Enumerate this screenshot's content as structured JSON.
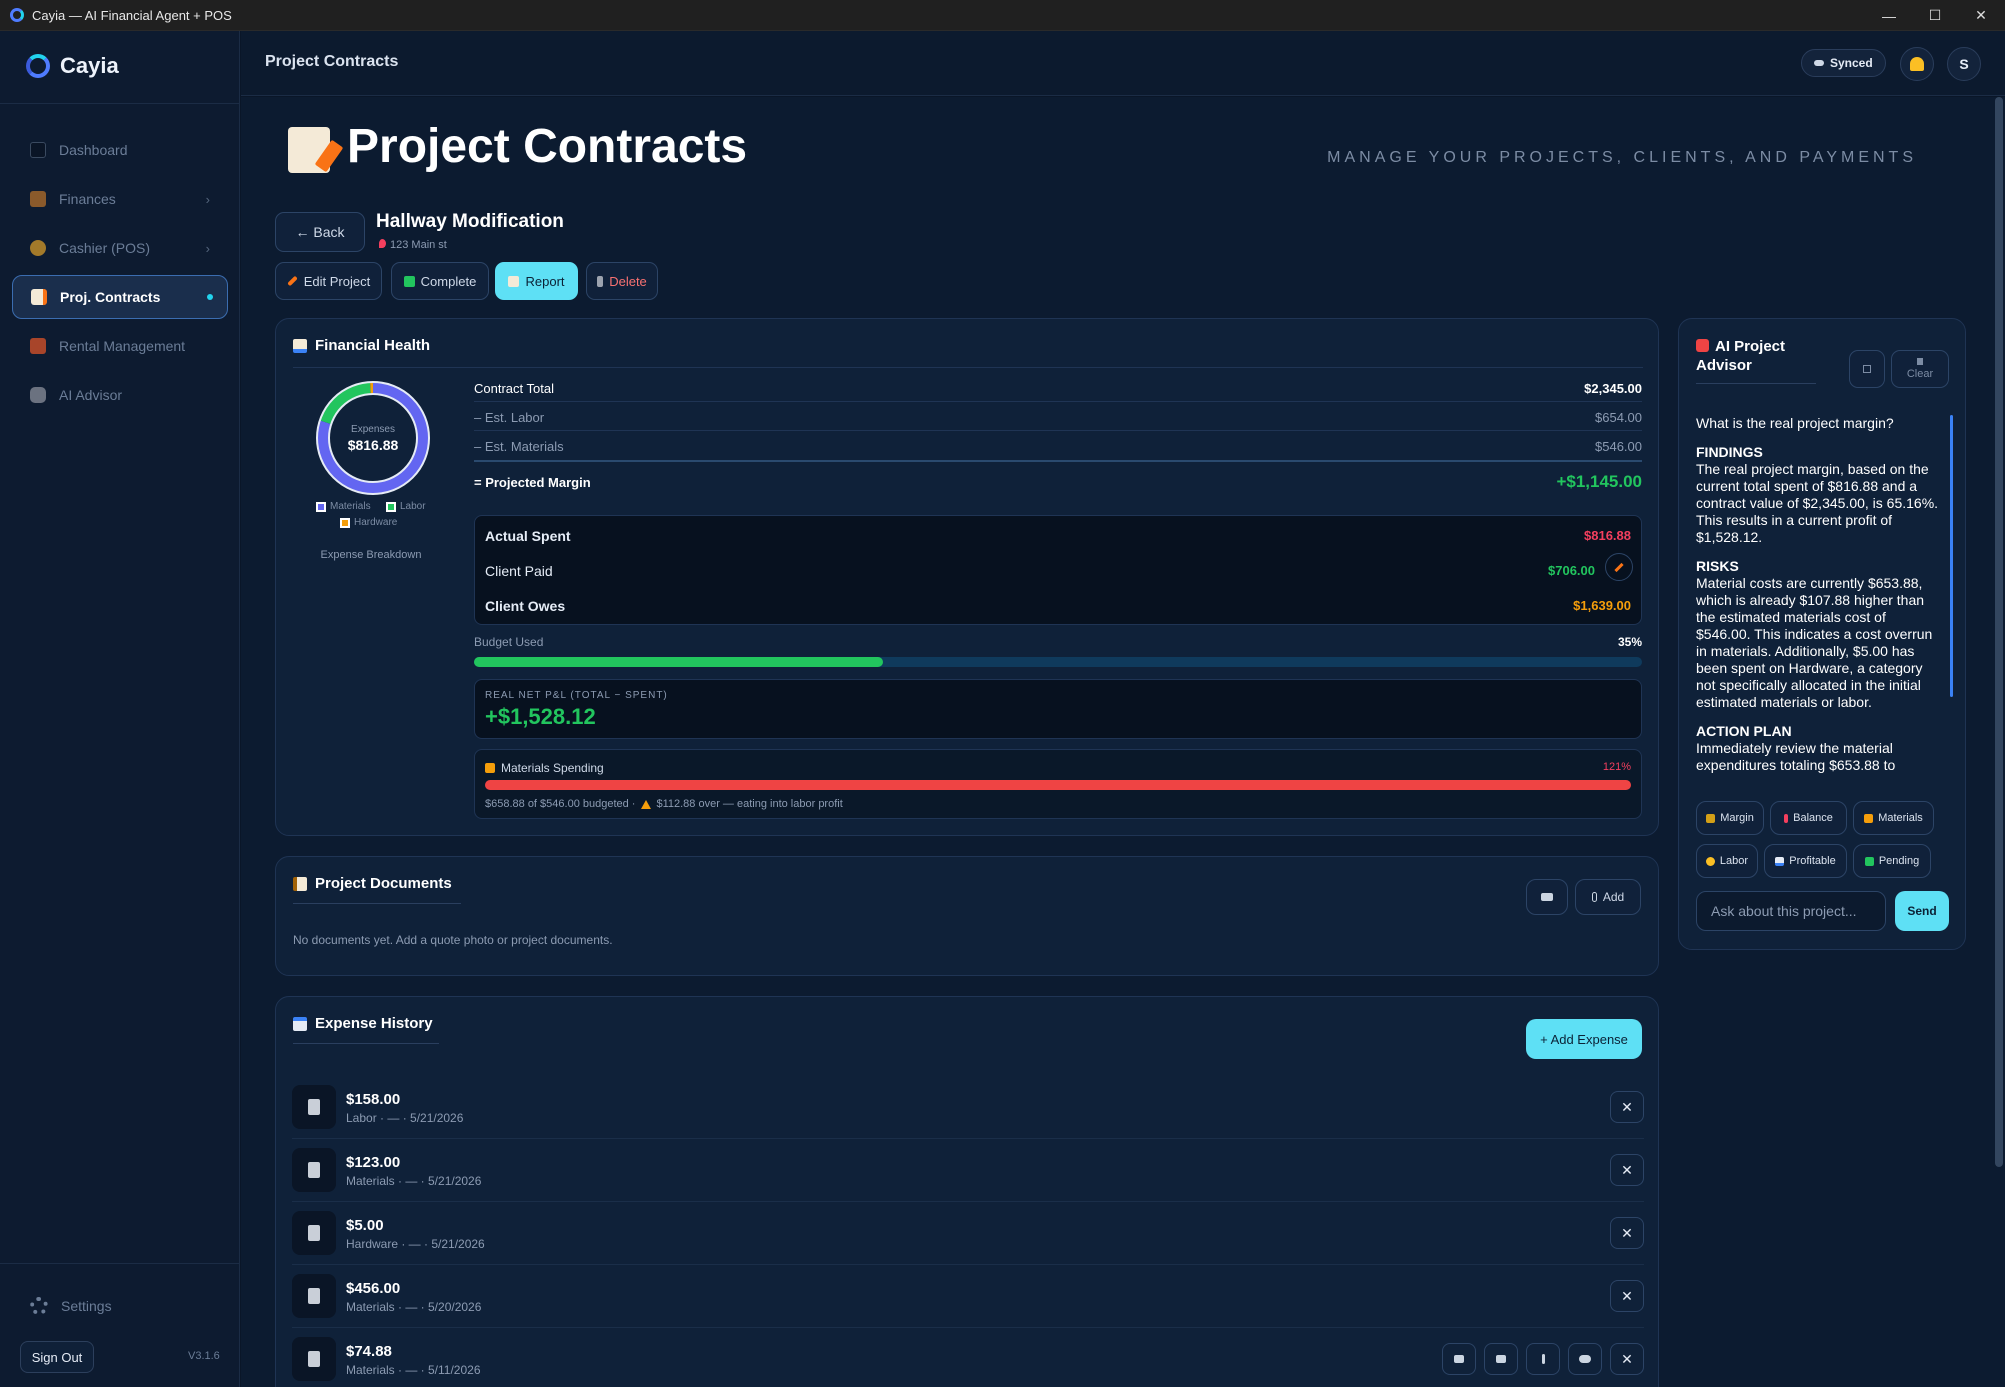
{
  "window": {
    "title": "Cayia — AI Financial Agent + POS",
    "minimize": "—",
    "maximize": "☐",
    "close": "✕"
  },
  "sidebar": {
    "brand": "Cayia",
    "items": [
      {
        "label": "Dashboard"
      },
      {
        "label": "Finances"
      },
      {
        "label": "Cashier (POS)"
      },
      {
        "label": "Proj. Contracts"
      },
      {
        "label": "Rental Management"
      },
      {
        "label": "AI Advisor"
      }
    ],
    "settings": "Settings",
    "sign_out": "Sign Out",
    "version": "V3.1.6"
  },
  "topbar": {
    "breadcrumb": "Project Contracts",
    "synced": "Synced",
    "avatar": "S"
  },
  "page": {
    "title": "Project Contracts",
    "subtitle": "MANAGE YOUR PROJECTS, CLIENTS, AND PAYMENTS",
    "back": "← Back",
    "project_name": "Hallway Modification",
    "project_address": "123 Main st",
    "actions": {
      "edit": "Edit Project",
      "complete": "Complete",
      "report": "Report",
      "delete": "Delete"
    }
  },
  "financial_health": {
    "title": "Financial Health",
    "donut_label": "Expenses",
    "donut_value": "$816.88",
    "donut_fractions": {
      "materials": 0.8,
      "labor": 0.19,
      "hardware": 0.01
    },
    "legend": [
      "Materials",
      "Labor",
      "Hardware"
    ],
    "breakdown_label": "Expense Breakdown",
    "contract_total_label": "Contract Total",
    "contract_total": "$2,345.00",
    "est_labor_label": "– Est. Labor",
    "est_labor": "$654.00",
    "est_materials_label": "– Est. Materials",
    "est_materials": "$546.00",
    "projected_margin_label": "= Projected Margin",
    "projected_margin": "+$1,145.00",
    "actual_spent_label": "Actual Spent",
    "actual_spent": "$816.88",
    "client_paid_label": "Client Paid",
    "client_paid": "$706.00",
    "client_owes_label": "Client Owes",
    "client_owes": "$1,639.00",
    "budget_used_label": "Budget Used",
    "budget_used": "35%",
    "budget_used_fraction": 0.35,
    "pnl_label": "REAL NET P&L (TOTAL − SPENT)",
    "pnl_value": "+$1,528.12",
    "materials_spending_label": "Materials Spending",
    "materials_spending_pct": "121%",
    "materials_spending_fraction": 1.0,
    "materials_note_a": "$658.88 of $546.00 budgeted ·",
    "materials_note_b": "$112.88 over — eating into labor profit"
  },
  "documents": {
    "title": "Project Documents",
    "add": "Add",
    "empty": "No documents yet. Add a quote photo or project documents."
  },
  "expenses": {
    "title": "Expense History",
    "add": "+ Add Expense",
    "rows": [
      {
        "amount": "$158.00",
        "meta": "Labor · — · 5/21/2026"
      },
      {
        "amount": "$123.00",
        "meta": "Materials · — · 5/21/2026"
      },
      {
        "amount": "$5.00",
        "meta": "Hardware · — · 5/21/2026"
      },
      {
        "amount": "$456.00",
        "meta": "Materials · — · 5/20/2026"
      },
      {
        "amount": "$74.88",
        "meta": "Materials · — · 5/11/2026"
      }
    ],
    "remove": "✕"
  },
  "advisor": {
    "title": "AI Project Advisor",
    "clear": "Clear",
    "question": "What is the real project margin?",
    "findings_h": "FINDINGS",
    "findings": "The real project margin, based on the current total spent of $816.88 and a contract value of $2,345.00, is 65.16%. This results in a current profit of $1,528.12.",
    "risks_h": "RISKS",
    "risks": "Material costs are currently $653.88, which is already $107.88 higher than the estimated materials cost of $546.00. This indicates a cost overrun in materials. Additionally, $5.00 has been spent on Hardware, a category not specifically allocated in the initial estimated materials or labor.",
    "plan_h": "ACTION PLAN",
    "plan": "Immediately review the material expenditures totaling $653.88 to",
    "chips": [
      "Margin",
      "Balance",
      "Materials",
      "Labor",
      "Profitable",
      "Pending"
    ],
    "input_placeholder": "Ask about this project...",
    "send": "Send"
  },
  "colors": {
    "accent": "#5ee0f5",
    "positive": "#22c55e",
    "negative": "#f43f5e",
    "warning": "#f59e0b",
    "materials": "#6366f1"
  }
}
